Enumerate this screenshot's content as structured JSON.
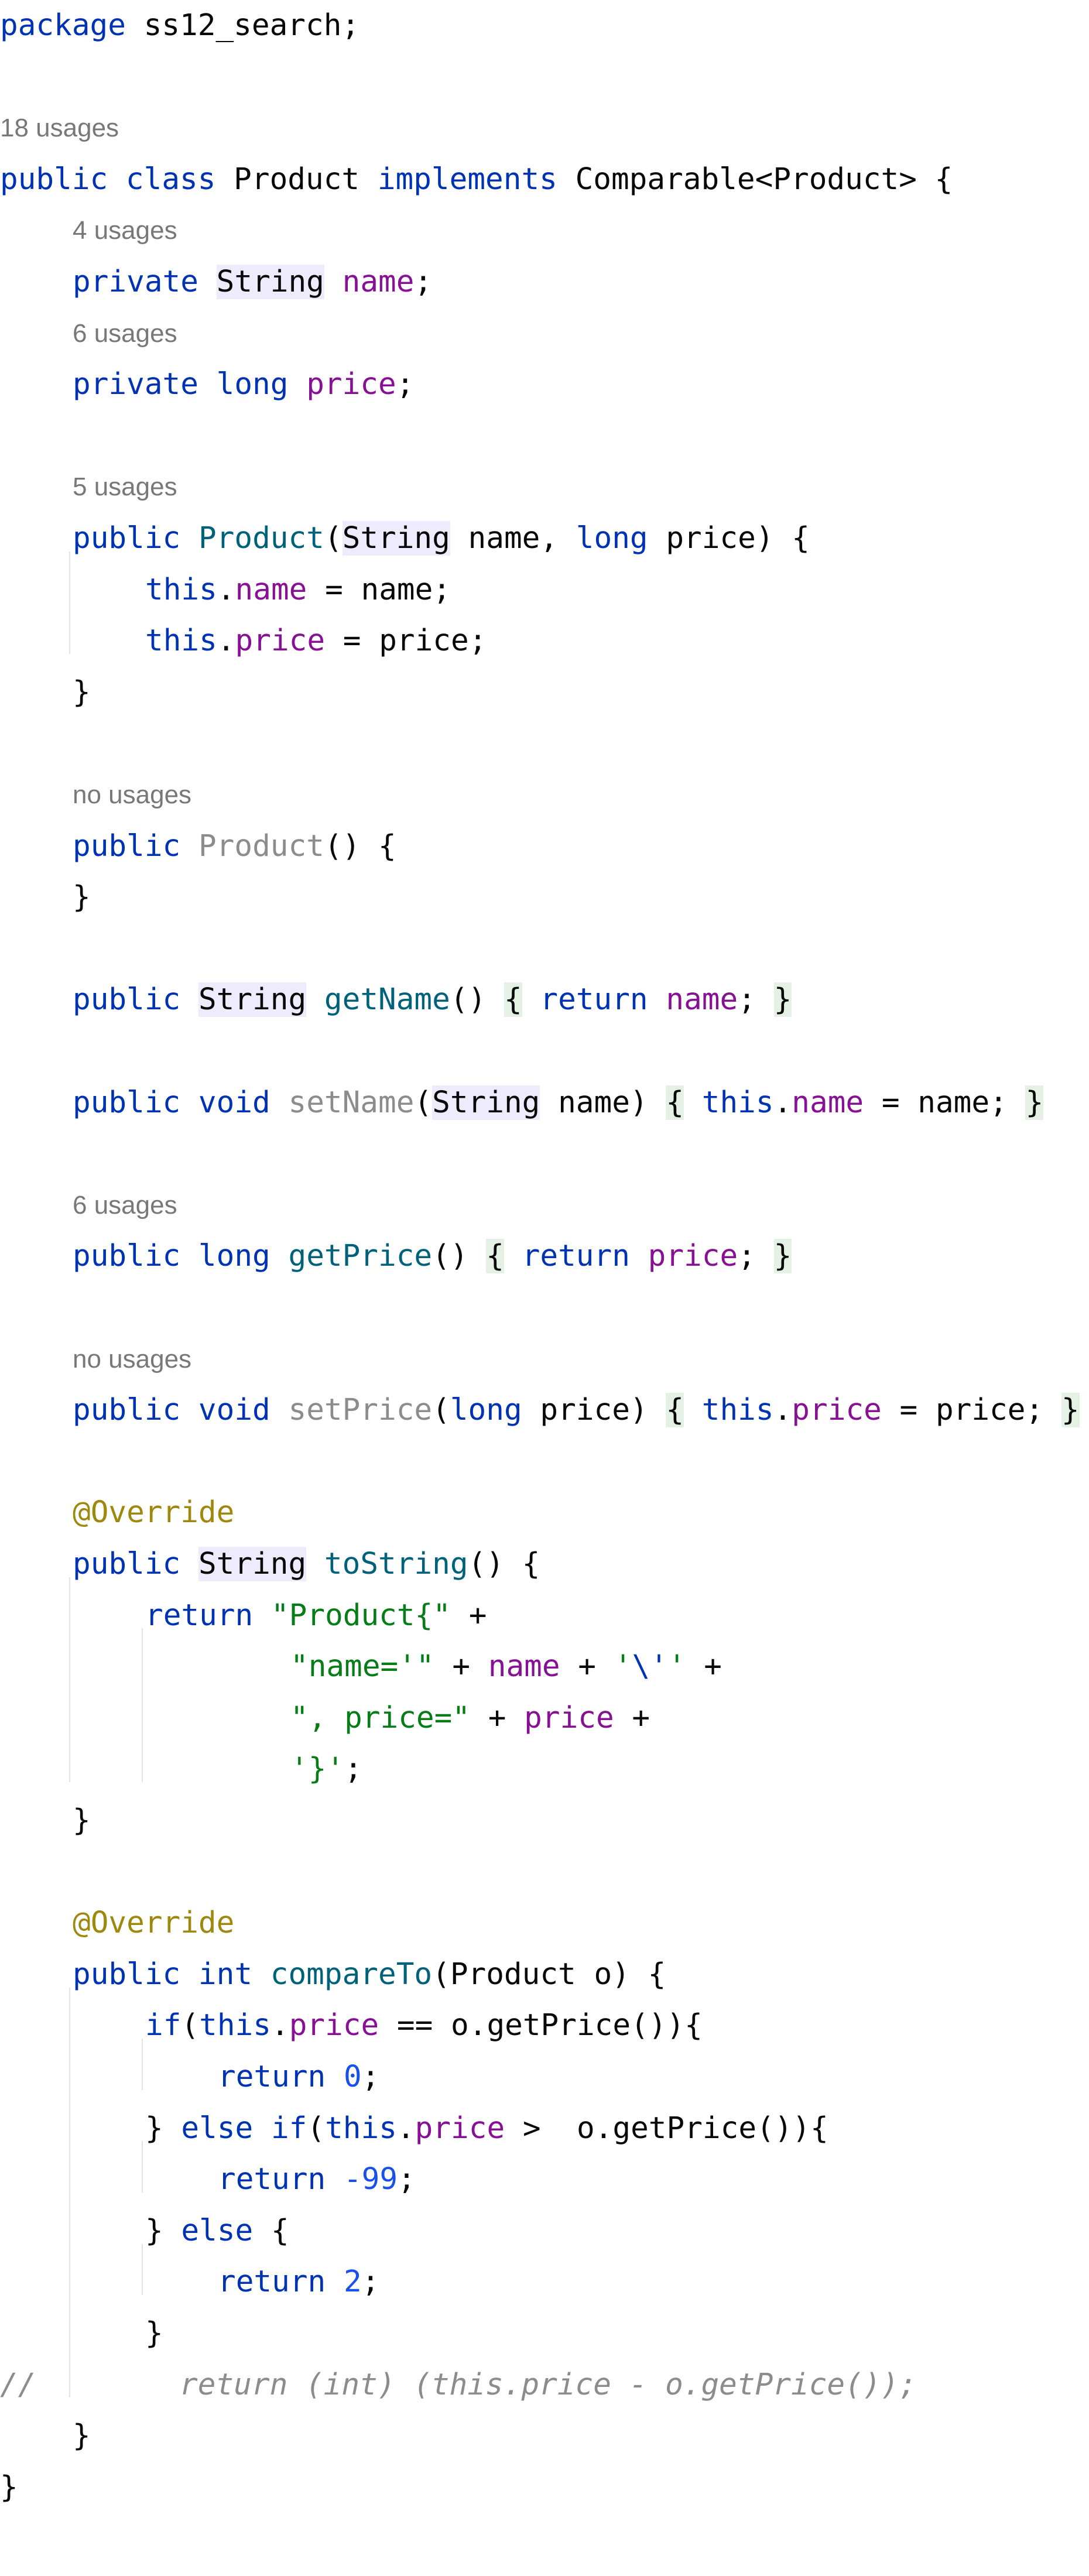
{
  "editor": {
    "file_language": "Java",
    "colors": {
      "keyword": "#0033b3",
      "field": "#871094",
      "string": "#067d17",
      "number": "#1750eb",
      "method_declaration": "#00627a",
      "unused_symbol": "#8c8c8c",
      "annotation": "#9e880d",
      "comment": "#8c8c8c",
      "usage_hint": "#787878",
      "type_highlight": "#edebfc",
      "folded_region": "#e4f1e4"
    },
    "lines": [
      {
        "row": 0,
        "indent": 0,
        "kind": "code",
        "tokens": [
          {
            "t": "package",
            "c": "kw"
          },
          {
            "t": " ss12_search;"
          }
        ]
      },
      {
        "row": 2,
        "indent": 0,
        "kind": "usage",
        "text": "18 usages"
      },
      {
        "row": 3,
        "indent": 0,
        "kind": "code",
        "tokens": [
          {
            "t": "public class",
            "c": "kw"
          },
          {
            "t": " Product "
          },
          {
            "t": "implements",
            "c": "kw"
          },
          {
            "t": " Comparable<Product> {"
          }
        ]
      },
      {
        "row": 4,
        "indent": 1,
        "kind": "usage",
        "text": "4 usages"
      },
      {
        "row": 5,
        "indent": 1,
        "kind": "code",
        "tokens": [
          {
            "t": "private",
            "c": "kw"
          },
          {
            "t": " "
          },
          {
            "t": "String",
            "c": "hl"
          },
          {
            "t": " "
          },
          {
            "t": "name",
            "c": "fld"
          },
          {
            "t": ";"
          }
        ]
      },
      {
        "row": 6,
        "indent": 1,
        "kind": "usage",
        "text": "6 usages"
      },
      {
        "row": 7,
        "indent": 1,
        "kind": "code",
        "tokens": [
          {
            "t": "private long",
            "c": "kw"
          },
          {
            "t": " "
          },
          {
            "t": "price",
            "c": "fld"
          },
          {
            "t": ";"
          }
        ]
      },
      {
        "row": 9,
        "indent": 1,
        "kind": "usage",
        "text": "5 usages"
      },
      {
        "row": 10,
        "indent": 1,
        "kind": "code",
        "tokens": [
          {
            "t": "public",
            "c": "kw"
          },
          {
            "t": " "
          },
          {
            "t": "Product",
            "c": "fn-decl"
          },
          {
            "t": "("
          },
          {
            "t": "String",
            "c": "hl"
          },
          {
            "t": " name, "
          },
          {
            "t": "long",
            "c": "kw"
          },
          {
            "t": " price) {"
          }
        ]
      },
      {
        "row": 11,
        "indent": 2,
        "kind": "code",
        "tokens": [
          {
            "t": "this",
            "c": "kw"
          },
          {
            "t": "."
          },
          {
            "t": "name",
            "c": "fld"
          },
          {
            "t": " = name;"
          }
        ]
      },
      {
        "row": 12,
        "indent": 2,
        "kind": "code",
        "tokens": [
          {
            "t": "this",
            "c": "kw"
          },
          {
            "t": "."
          },
          {
            "t": "price",
            "c": "fld"
          },
          {
            "t": " = price;"
          }
        ]
      },
      {
        "row": 13,
        "indent": 1,
        "kind": "code",
        "tokens": [
          {
            "t": "}"
          }
        ]
      },
      {
        "row": 15,
        "indent": 1,
        "kind": "usage",
        "text": "no usages"
      },
      {
        "row": 16,
        "indent": 1,
        "kind": "code",
        "tokens": [
          {
            "t": "public",
            "c": "kw"
          },
          {
            "t": " "
          },
          {
            "t": "Product",
            "c": "unused"
          },
          {
            "t": "() {"
          }
        ]
      },
      {
        "row": 17,
        "indent": 1,
        "kind": "code",
        "tokens": [
          {
            "t": "}"
          }
        ]
      },
      {
        "row": 19,
        "indent": 1,
        "kind": "code",
        "tokens": [
          {
            "t": "public",
            "c": "kw"
          },
          {
            "t": " "
          },
          {
            "t": "String",
            "c": "hl"
          },
          {
            "t": " "
          },
          {
            "t": "getName",
            "c": "fn-decl"
          },
          {
            "t": "() "
          },
          {
            "t": "{",
            "c": "fold"
          },
          {
            "t": " "
          },
          {
            "t": "return",
            "c": "kw"
          },
          {
            "t": " "
          },
          {
            "t": "name",
            "c": "fld"
          },
          {
            "t": "; "
          },
          {
            "t": "}",
            "c": "fold"
          }
        ]
      },
      {
        "row": 21,
        "indent": 1,
        "kind": "code",
        "tokens": [
          {
            "t": "public void",
            "c": "kw"
          },
          {
            "t": " "
          },
          {
            "t": "setName",
            "c": "unused"
          },
          {
            "t": "("
          },
          {
            "t": "String",
            "c": "hl"
          },
          {
            "t": " name) "
          },
          {
            "t": "{",
            "c": "fold"
          },
          {
            "t": " "
          },
          {
            "t": "this",
            "c": "kw"
          },
          {
            "t": "."
          },
          {
            "t": "name",
            "c": "fld"
          },
          {
            "t": " = name; "
          },
          {
            "t": "}",
            "c": "fold"
          }
        ]
      },
      {
        "row": 23,
        "indent": 1,
        "kind": "usage",
        "text": "6 usages"
      },
      {
        "row": 24,
        "indent": 1,
        "kind": "code",
        "tokens": [
          {
            "t": "public long",
            "c": "kw"
          },
          {
            "t": " "
          },
          {
            "t": "getPrice",
            "c": "fn-decl"
          },
          {
            "t": "() "
          },
          {
            "t": "{",
            "c": "fold"
          },
          {
            "t": " "
          },
          {
            "t": "return",
            "c": "kw"
          },
          {
            "t": " "
          },
          {
            "t": "price",
            "c": "fld"
          },
          {
            "t": "; "
          },
          {
            "t": "}",
            "c": "fold"
          }
        ]
      },
      {
        "row": 26,
        "indent": 1,
        "kind": "usage",
        "text": "no usages"
      },
      {
        "row": 27,
        "indent": 1,
        "kind": "code",
        "tokens": [
          {
            "t": "public void",
            "c": "kw"
          },
          {
            "t": " "
          },
          {
            "t": "setPrice",
            "c": "unused"
          },
          {
            "t": "("
          },
          {
            "t": "long",
            "c": "kw"
          },
          {
            "t": " price) "
          },
          {
            "t": "{",
            "c": "fold"
          },
          {
            "t": " "
          },
          {
            "t": "this",
            "c": "kw"
          },
          {
            "t": "."
          },
          {
            "t": "price",
            "c": "fld"
          },
          {
            "t": " = price; "
          },
          {
            "t": "}",
            "c": "fold"
          }
        ]
      },
      {
        "row": 29,
        "indent": 1,
        "kind": "code",
        "tokens": [
          {
            "t": "@Override",
            "c": "ann"
          }
        ]
      },
      {
        "row": 30,
        "indent": 1,
        "kind": "code",
        "tokens": [
          {
            "t": "public",
            "c": "kw"
          },
          {
            "t": " "
          },
          {
            "t": "String",
            "c": "hl"
          },
          {
            "t": " "
          },
          {
            "t": "toString",
            "c": "fn-decl"
          },
          {
            "t": "() {"
          }
        ]
      },
      {
        "row": 31,
        "indent": 2,
        "kind": "code",
        "tokens": [
          {
            "t": "return",
            "c": "kw"
          },
          {
            "t": " "
          },
          {
            "t": "\"Product{\"",
            "c": "str"
          },
          {
            "t": " +"
          }
        ]
      },
      {
        "row": 32,
        "indent": 4,
        "kind": "code",
        "tokens": [
          {
            "t": "\"name='\"",
            "c": "str"
          },
          {
            "t": " + "
          },
          {
            "t": "name",
            "c": "fld"
          },
          {
            "t": " + "
          },
          {
            "t": "'",
            "c": "str"
          },
          {
            "t": "\\'",
            "c": "kw"
          },
          {
            "t": "'",
            "c": "str"
          },
          {
            "t": " +"
          }
        ]
      },
      {
        "row": 33,
        "indent": 4,
        "kind": "code",
        "tokens": [
          {
            "t": "\", price=\"",
            "c": "str"
          },
          {
            "t": " + "
          },
          {
            "t": "price",
            "c": "fld"
          },
          {
            "t": " +"
          }
        ]
      },
      {
        "row": 34,
        "indent": 4,
        "kind": "code",
        "tokens": [
          {
            "t": "'}'",
            "c": "str"
          },
          {
            "t": ";"
          }
        ]
      },
      {
        "row": 35,
        "indent": 1,
        "kind": "code",
        "tokens": [
          {
            "t": "}"
          }
        ]
      },
      {
        "row": 37,
        "indent": 1,
        "kind": "code",
        "tokens": [
          {
            "t": "@Override",
            "c": "ann"
          }
        ]
      },
      {
        "row": 38,
        "indent": 1,
        "kind": "code",
        "tokens": [
          {
            "t": "public int",
            "c": "kw"
          },
          {
            "t": " "
          },
          {
            "t": "compareTo",
            "c": "fn-decl"
          },
          {
            "t": "(Product o) {"
          }
        ]
      },
      {
        "row": 39,
        "indent": 2,
        "kind": "code",
        "tokens": [
          {
            "t": "if",
            "c": "kw"
          },
          {
            "t": "("
          },
          {
            "t": "this",
            "c": "kw"
          },
          {
            "t": "."
          },
          {
            "t": "price",
            "c": "fld"
          },
          {
            "t": " == o.getPrice()){"
          }
        ]
      },
      {
        "row": 40,
        "indent": 3,
        "kind": "code",
        "tokens": [
          {
            "t": "return",
            "c": "kw"
          },
          {
            "t": " "
          },
          {
            "t": "0",
            "c": "num"
          },
          {
            "t": ";"
          }
        ]
      },
      {
        "row": 41,
        "indent": 2,
        "kind": "code",
        "tokens": [
          {
            "t": "} "
          },
          {
            "t": "else if",
            "c": "kw"
          },
          {
            "t": "("
          },
          {
            "t": "this",
            "c": "kw"
          },
          {
            "t": "."
          },
          {
            "t": "price",
            "c": "fld"
          },
          {
            "t": " >  o.getPrice()){"
          }
        ]
      },
      {
        "row": 42,
        "indent": 3,
        "kind": "code",
        "tokens": [
          {
            "t": "return",
            "c": "kw"
          },
          {
            "t": " "
          },
          {
            "t": "-99",
            "c": "num"
          },
          {
            "t": ";"
          }
        ]
      },
      {
        "row": 43,
        "indent": 2,
        "kind": "code",
        "tokens": [
          {
            "t": "} "
          },
          {
            "t": "else",
            "c": "kw"
          },
          {
            "t": " {"
          }
        ]
      },
      {
        "row": 44,
        "indent": 3,
        "kind": "code",
        "tokens": [
          {
            "t": "return",
            "c": "kw"
          },
          {
            "t": " "
          },
          {
            "t": "2",
            "c": "num"
          },
          {
            "t": ";"
          }
        ]
      },
      {
        "row": 45,
        "indent": 2,
        "kind": "code",
        "tokens": [
          {
            "t": "}"
          }
        ]
      },
      {
        "row": 46,
        "indent": 0,
        "kind": "code",
        "tokens": [
          {
            "t": "//        return (int) (this.price - o.getPrice());",
            "c": "cmt"
          }
        ]
      },
      {
        "row": 47,
        "indent": 1,
        "kind": "code",
        "tokens": [
          {
            "t": "}"
          }
        ]
      },
      {
        "row": 48,
        "indent": 0,
        "kind": "code",
        "tokens": [
          {
            "t": "}"
          }
        ]
      }
    ]
  }
}
